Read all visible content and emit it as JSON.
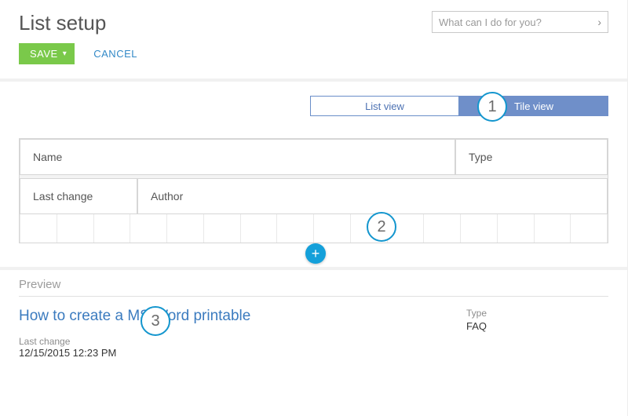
{
  "header": {
    "title": "List setup",
    "search_placeholder": "What can I do for you?"
  },
  "actions": {
    "save_label": "SAVE",
    "cancel_label": "CANCEL"
  },
  "tabs": {
    "list_view": "List view",
    "tile_view": "Tile view"
  },
  "columns": {
    "name": "Name",
    "type": "Type",
    "last_change": "Last change",
    "author": "Author"
  },
  "callouts": {
    "one": "1",
    "two": "2",
    "three": "3"
  },
  "preview": {
    "section_label": "Preview",
    "title": "How to create a MS Word printable",
    "type_label": "Type",
    "type_value": "FAQ",
    "last_change_label": "Last change",
    "last_change_value": "12/15/2015 12:23 PM"
  }
}
